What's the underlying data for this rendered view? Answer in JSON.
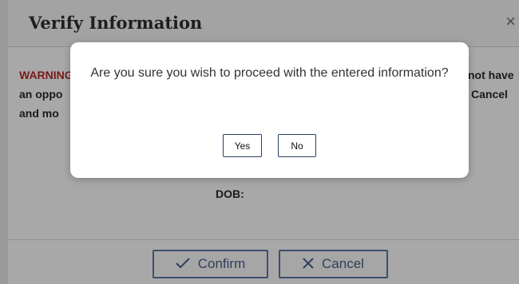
{
  "modal": {
    "title": "Verify Information",
    "close_glyph": "×",
    "warning": {
      "line1_label": "WARNING",
      "line1_tail": "not have",
      "line2_head": "an oppo",
      "line2_tail": "Cancel",
      "line3_head": "and mo"
    },
    "dob_label": "DOB:",
    "confirm_label": "Confirm",
    "confirm_icon": "check-icon",
    "cancel_label": "Cancel",
    "cancel_icon": "x-icon",
    "colors": {
      "warning": "#7a1a16",
      "button_border": "#3d4e6e"
    }
  },
  "dialog": {
    "message": "Are you sure you wish to proceed with the entered information?",
    "yes_label": "Yes",
    "no_label": "No"
  }
}
